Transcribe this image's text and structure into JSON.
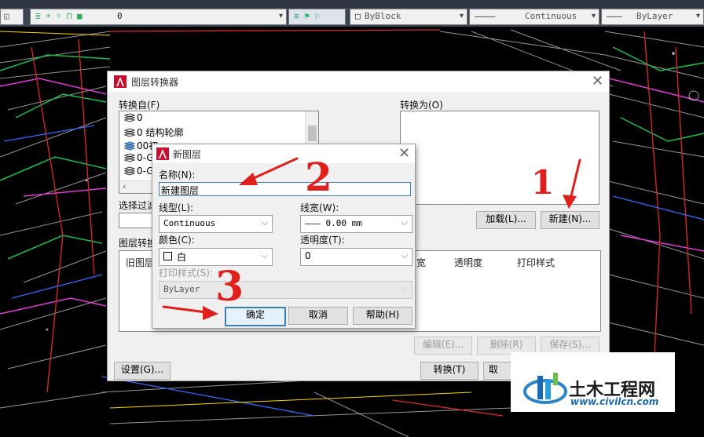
{
  "toolbar": {
    "layer_value": "0",
    "color_value": "ByBlock",
    "linetype_value": "Continuous",
    "lineweight_value": "ByLayer"
  },
  "layer_translator": {
    "title": "图层转换器",
    "translate_from_label": "转换自(F)",
    "from_layers": [
      "0",
      "0 结构轮廓",
      "00初",
      "0-G",
      "0-G"
    ],
    "translate_to_label": "转换为(O)",
    "selection_filter_label": "选择过滤",
    "load_button": "加载(L)...",
    "new_button": "新建(N)...",
    "mappings_label": "图层转换",
    "table_headers": [
      "旧图层",
      "宽",
      "透明度",
      "打印样式"
    ],
    "edit_button": "编辑(E)...",
    "delete_button": "删除(R)",
    "save_button": "保存(S)...",
    "settings_button": "设置(G)...",
    "translate_button": "转换(T)",
    "cancel_button_partial": "取"
  },
  "new_layer": {
    "title": "新图层",
    "name_label": "名称(N):",
    "name_value": "新建图层",
    "linetype_label": "线型(L):",
    "linetype_value": "Continuous",
    "lineweight_label": "线宽(W):",
    "lineweight_value": "——— 0.00 mm",
    "color_label": "颜色(C):",
    "color_value": "白",
    "transparency_label": "透明度(T):",
    "transparency_value": "0",
    "plot_style_label": "打印样式(S):",
    "plot_style_value": "ByLayer",
    "ok_button": "确定",
    "cancel_button": "取消",
    "help_button": "帮助(H)"
  },
  "annotations": {
    "step1": "1",
    "step2": "2",
    "step3": "3"
  },
  "watermark": {
    "brand": "土木工程网",
    "url": "www.civilcn.com"
  },
  "colors": {
    "annotation_red": "#e0201c",
    "cad_background": "#000000",
    "accent_blue": "#1a6bb5"
  }
}
